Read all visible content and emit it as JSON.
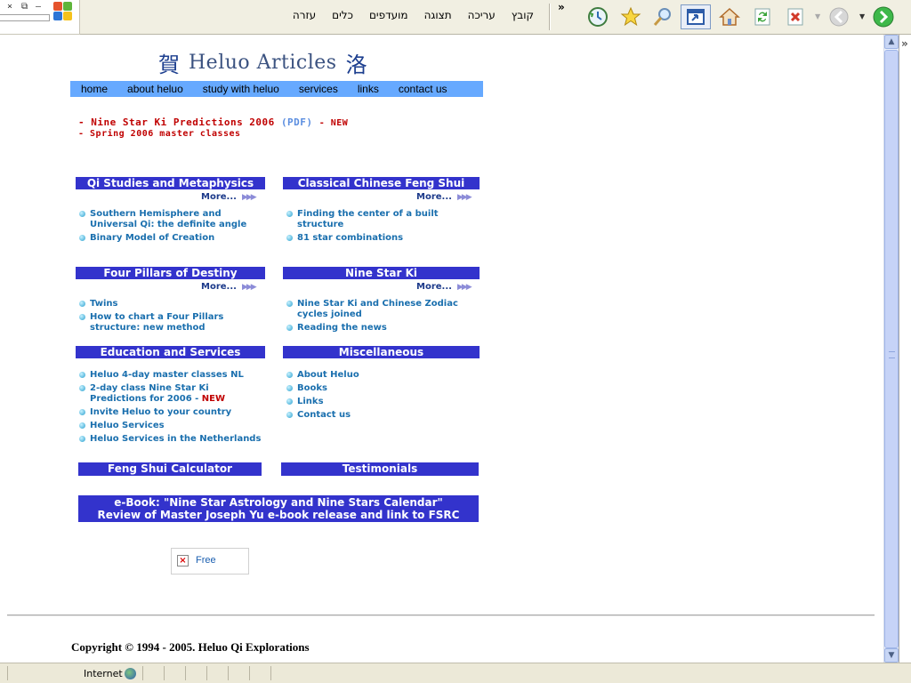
{
  "browser": {
    "menus": [
      "קובץ",
      "עריכה",
      "תצוגה",
      "מועדפים",
      "כלים",
      "עזרה"
    ],
    "chevron": "»",
    "window_controls": [
      "–",
      "⧉",
      "×"
    ],
    "toolbar_icons": [
      "forward-icon",
      "back-icon",
      "stop-icon",
      "refresh-icon",
      "home-icon",
      "view-icon",
      "search-icon",
      "favorites-icon",
      "history-icon"
    ],
    "status_zone": "Internet"
  },
  "page": {
    "logo": {
      "left_glyph": "賀",
      "text": "Heluo Articles",
      "right_glyph": "洛"
    },
    "nav": [
      "home",
      "about heluo",
      "study with heluo",
      "services",
      "links",
      "contact us"
    ],
    "news": [
      {
        "text": "- Nine Star Ki Predictions 2006",
        "pdf": "(PDF)",
        "suffix": "- NEW"
      },
      {
        "text": "- Spring 2006 master classes"
      }
    ],
    "sections": [
      {
        "title": "Qi Studies and Metaphysics",
        "more": "More...",
        "items": [
          "Southern Hemisphere and Universal Qi: the definite angle",
          "Binary Model of Creation"
        ]
      },
      {
        "title": "Classical Chinese Feng Shui",
        "more": "More...",
        "items": [
          "Finding the center of a built structure",
          "81 star combinations"
        ]
      },
      {
        "title": "Four Pillars of Destiny",
        "more": "More...",
        "items": [
          "Twins",
          "How to chart a Four Pillars structure: new method"
        ]
      },
      {
        "title": "Nine Star Ki",
        "more": "More...",
        "items": [
          "Nine Star Ki and Chinese Zodiac cycles joined",
          "Reading the news"
        ]
      },
      {
        "title": "Education and Services",
        "items": [
          "Heluo 4-day master classes NL",
          "2-day class Nine Star Ki Predictions for 2006 -",
          "Invite Heluo to your country",
          "Heluo Services",
          "Heluo Services in the Netherlands"
        ],
        "new_label": "NEW"
      },
      {
        "title": "Miscellaneous",
        "items": [
          "About Heluo",
          "Books",
          "Links",
          "Contact us"
        ]
      }
    ],
    "bottom_buttons": [
      "Feng Shui Calculator",
      "Testimonials"
    ],
    "ebook": {
      "line1": "e-Book: \"Nine Star Astrology and Nine Stars Calendar\"",
      "line2": "Review of Master Joseph Yu e-book release and link to FSRC"
    },
    "free_label": "Free",
    "copyright": "Copyright © 1994 - 2005. Heluo Qi Explorations"
  }
}
